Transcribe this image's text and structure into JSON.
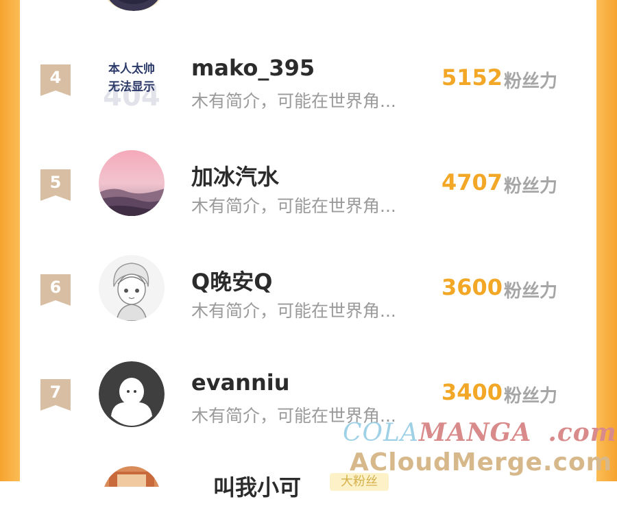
{
  "rows": [
    {
      "rank": "4",
      "username": "mako_395",
      "bio": "木有简介，可能在世界角...",
      "score": "5152",
      "score_unit": "粉丝力",
      "avatar_text_1": "本人太帅",
      "avatar_text_2": "无法显示",
      "avatar_text_bg": "404"
    },
    {
      "rank": "5",
      "username": "加冰汽水",
      "bio": "木有简介，可能在世界角...",
      "score": "4707",
      "score_unit": "粉丝力"
    },
    {
      "rank": "6",
      "username": "Q晚安Q",
      "bio": "木有简介，可能在世界角...",
      "score": "3600",
      "score_unit": "粉丝力"
    },
    {
      "rank": "7",
      "username": "evanniu",
      "bio": "木有简介，可能在世界角...",
      "score": "3400",
      "score_unit": "粉丝力"
    }
  ],
  "partial_row": {
    "username": "叫我小可",
    "tag": "大粉丝"
  },
  "watermark": {
    "line1_a": "COLA",
    "line1_b": "MANGA",
    "line1_c": ".com",
    "line2": "ACloudMerge.com"
  },
  "colors": {
    "accent": "#f3a726",
    "side": "#f7a93a",
    "badge": "#d8bfa3",
    "username": "#2b2b2b",
    "muted": "#9a9a9a"
  }
}
